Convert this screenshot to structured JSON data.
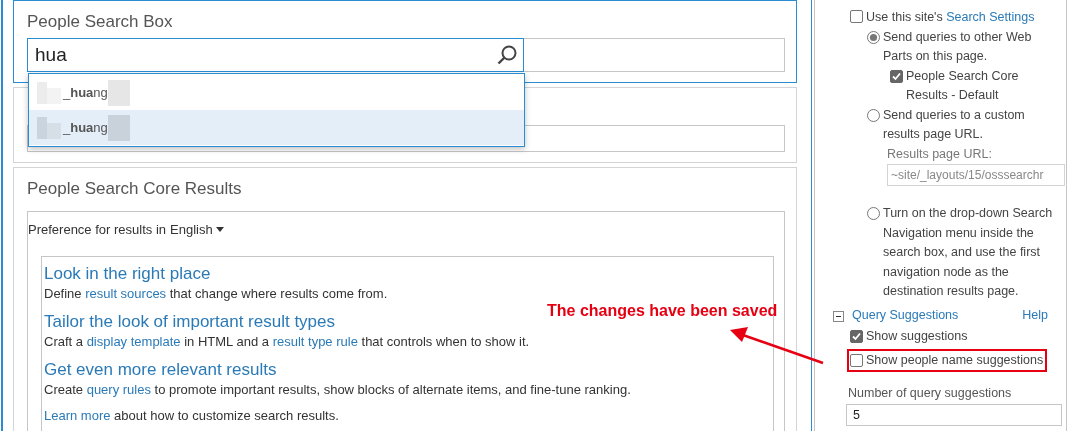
{
  "search_box_part": {
    "title": "People Search Box",
    "query": "hua",
    "suggestions": [
      {
        "text": "_**hua**ng",
        "selected": false
      },
      {
        "text": "_**hua**ng",
        "selected": true
      }
    ]
  },
  "results_part": {
    "title": "People Search Core Results",
    "preference_label": "Preference for results in",
    "language": "English",
    "tips": [
      {
        "heading": "Look in the right place",
        "parts": [
          {
            "kind": "text",
            "text": "Define"
          },
          {
            "kind": "link",
            "text": "result sources"
          },
          {
            "kind": "text",
            "text": "that change where results come from."
          }
        ]
      },
      {
        "heading": "Tailor the look of important result types",
        "parts": [
          {
            "kind": "text",
            "text": "Craft a"
          },
          {
            "kind": "link",
            "text": "display template"
          },
          {
            "kind": "text",
            "text": "in HTML and a"
          },
          {
            "kind": "link",
            "text": "result type rule"
          },
          {
            "kind": "text",
            "text": "that controls when to show it."
          }
        ]
      },
      {
        "heading": "Get even more relevant results",
        "parts": [
          {
            "kind": "text",
            "text": "Create"
          },
          {
            "kind": "link",
            "text": "query rules"
          },
          {
            "kind": "text",
            "text": "to promote important results, show blocks of alternate items, and fine-tune ranking."
          }
        ]
      }
    ],
    "learn_more": {
      "link": "Learn more",
      "text": "about how to customize search results."
    }
  },
  "annotation": {
    "text": "The changes have been saved"
  },
  "tool_pane": {
    "use_site_settings": {
      "label": "Use this site's",
      "link": "Search Settings",
      "checked": false
    },
    "query_targets": [
      {
        "label": "Send queries to other Web Parts on this page.",
        "selected": true,
        "sub_checkbox": {
          "label": "People Search Core Results - Default",
          "checked": true
        }
      },
      {
        "label": "Send queries to a custom results page URL.",
        "selected": false,
        "url_field": {
          "label": "Results page URL:",
          "value": "~site/_layouts/15/osssearchr",
          "disabled": true
        }
      },
      {
        "label": "Turn on the drop-down Search Navigation menu inside the search box, and use the first navigation node as the destination results page.",
        "selected": false
      }
    ],
    "query_suggestions": {
      "title": "Query Suggestions",
      "expanded": true,
      "help": "Help",
      "options": [
        {
          "label": "Show suggestions",
          "checked": true,
          "annotated": false
        },
        {
          "label": "Show people name suggestions",
          "checked": false,
          "annotated": true
        }
      ],
      "count_label": "Number of query suggestions",
      "count": "5"
    }
  }
}
